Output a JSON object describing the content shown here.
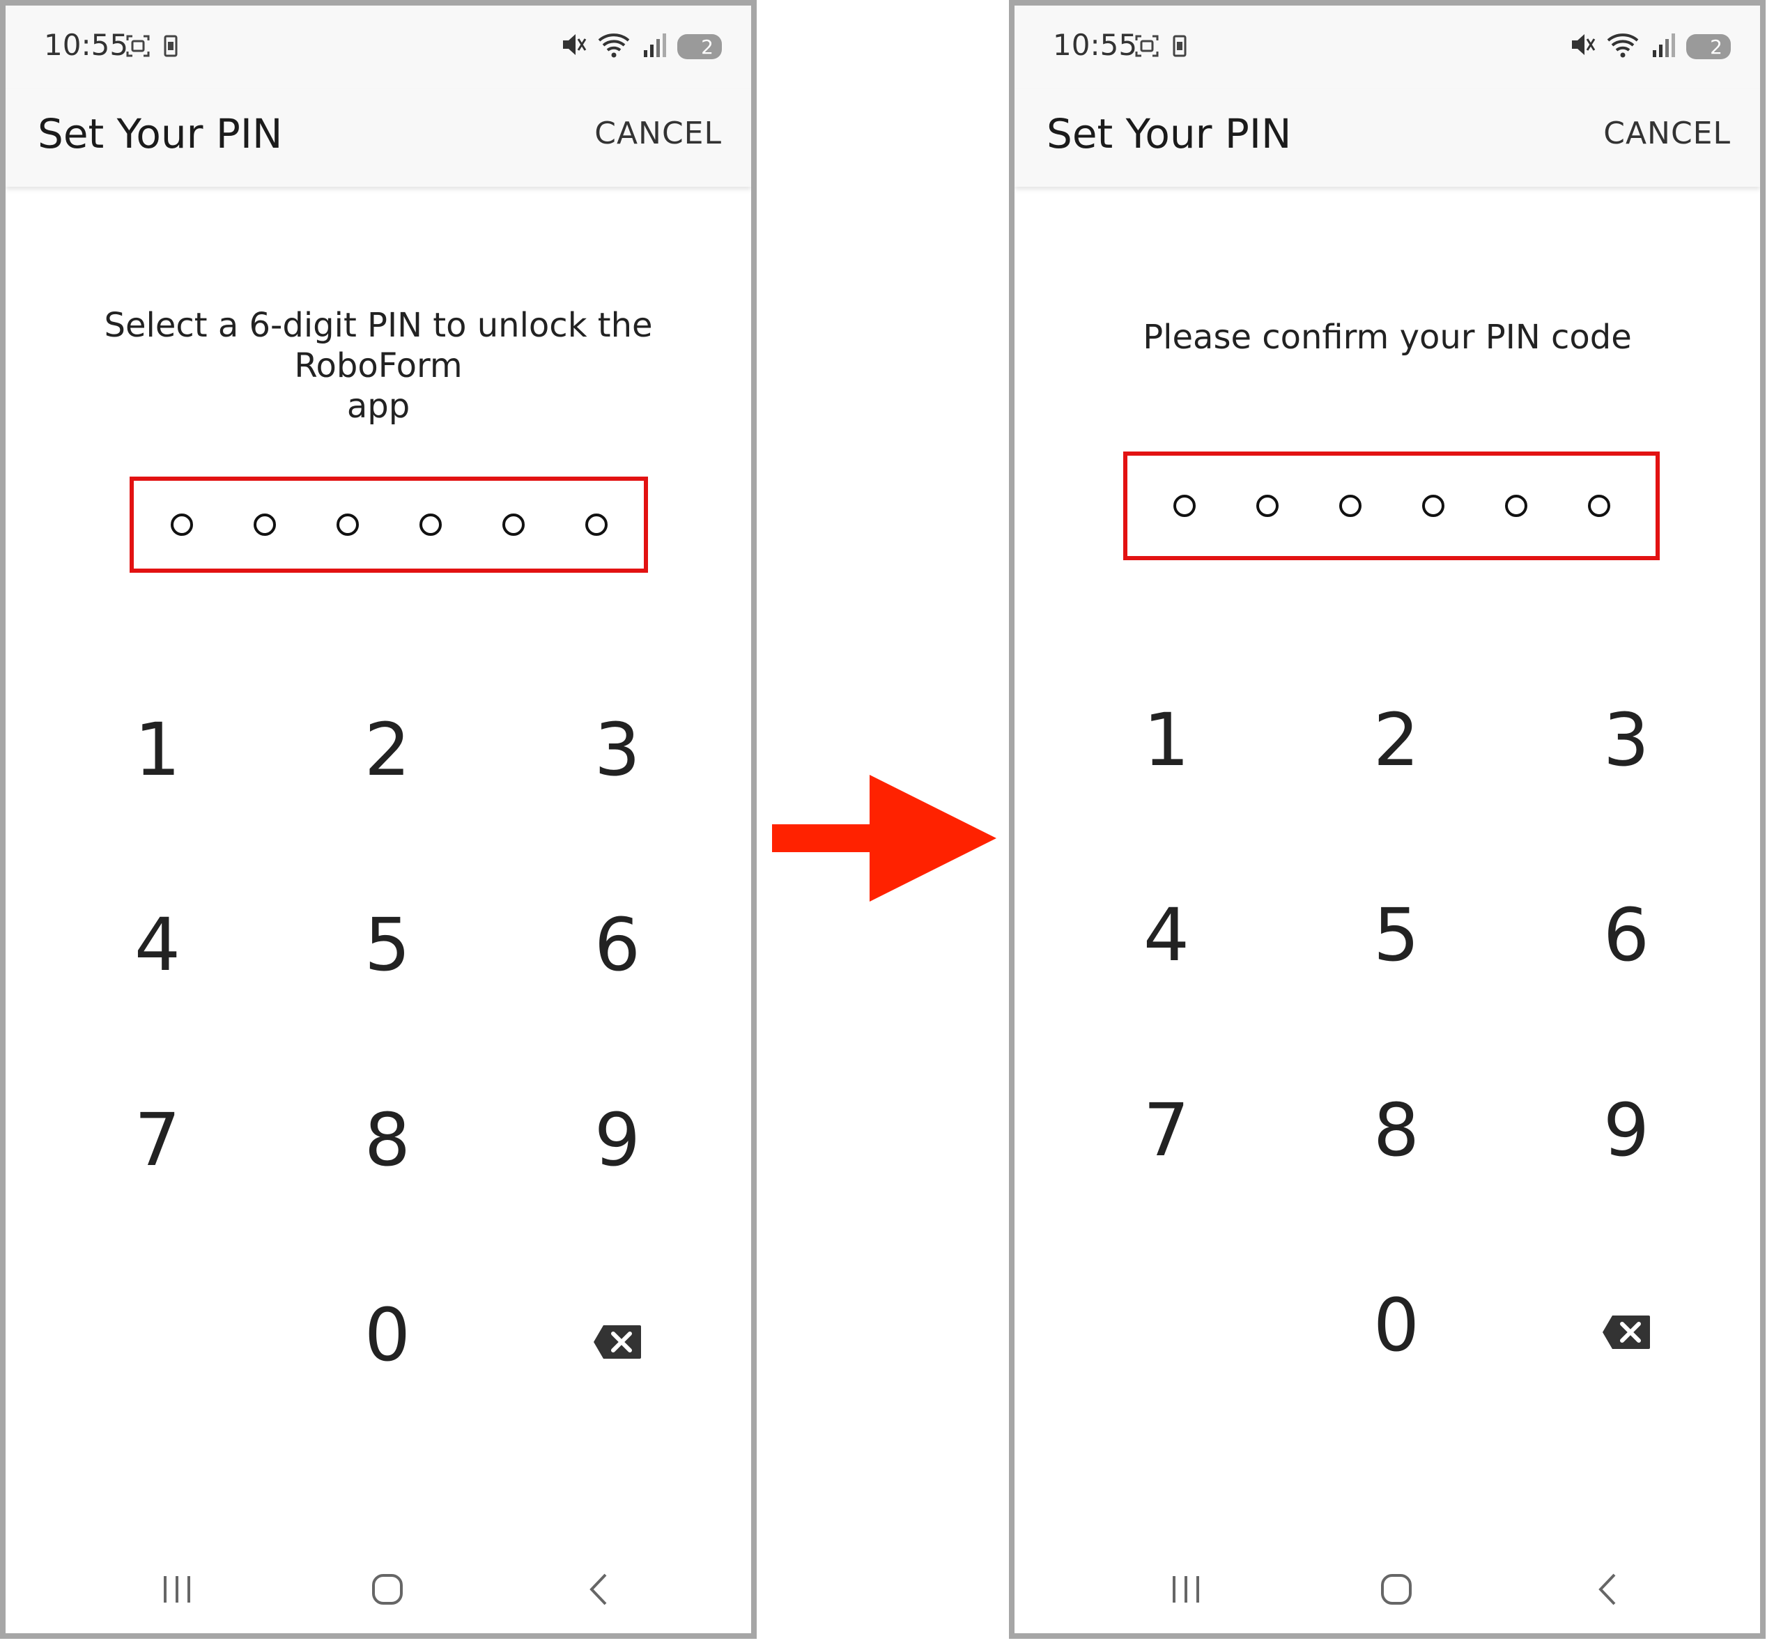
{
  "screens": [
    {
      "status": {
        "time": "10:55",
        "battery": "2"
      },
      "title": "Set Your PIN",
      "cancel_label": "CANCEL",
      "prompt_line1": "Select a 6-digit PIN to unlock the RoboForm",
      "prompt_line2": "app",
      "pin_length": 6,
      "keys": {
        "k1": "1",
        "k2": "2",
        "k3": "3",
        "k4": "4",
        "k5": "5",
        "k6": "6",
        "k7": "7",
        "k8": "8",
        "k9": "9",
        "k0": "0"
      }
    },
    {
      "status": {
        "time": "10:55",
        "battery": "2"
      },
      "title": "Set Your PIN",
      "cancel_label": "CANCEL",
      "prompt_line1": "Please confirm your PIN code",
      "prompt_line2": "",
      "pin_length": 6,
      "keys": {
        "k1": "1",
        "k2": "2",
        "k3": "3",
        "k4": "4",
        "k5": "5",
        "k6": "6",
        "k7": "7",
        "k8": "8",
        "k9": "9",
        "k0": "0"
      }
    }
  ],
  "colors": {
    "highlight_box": "#e21212",
    "arrow": "#ff2200",
    "panel_border": "#a6a6a6",
    "app_bar": "#f8f8f8"
  },
  "icons": [
    "screenshot-icon",
    "device-icon",
    "mute-icon",
    "wifi-icon",
    "signal-icon",
    "battery-icon",
    "backspace-icon",
    "recents-icon",
    "home-icon",
    "back-icon",
    "arrow-right-icon"
  ]
}
